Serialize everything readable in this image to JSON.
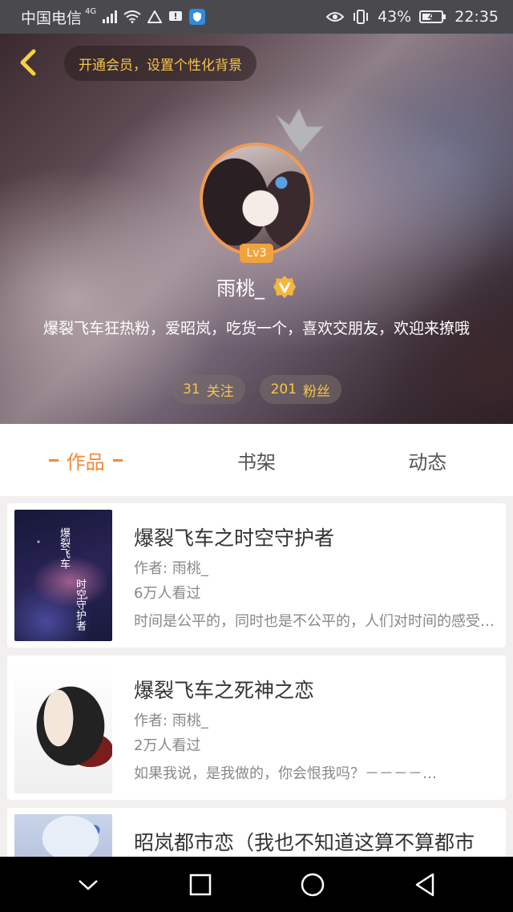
{
  "status_bar": {
    "carrier": "中国电信",
    "network": "4G",
    "battery": "43%",
    "time": "22:35"
  },
  "header": {
    "vip_prompt": "开通会员，设置个性化背景",
    "level": "Lv3",
    "username": "雨桃_",
    "bio": "爆裂飞车狂热粉，爱昭岚，吃货一个，喜欢交朋友，欢迎来撩哦",
    "following": {
      "count": "31",
      "label": "关注"
    },
    "followers": {
      "count": "201",
      "label": "粉丝"
    }
  },
  "tabs": [
    {
      "label": "作品",
      "active": true
    },
    {
      "label": "书架",
      "active": false
    },
    {
      "label": "动态",
      "active": false
    }
  ],
  "works": [
    {
      "title": "爆裂飞车之时空守护者",
      "author": "作者: 雨桃_",
      "views": "6万人看过",
      "desc": "时间是公平的，同时也是不公平的，人们对时间的感受…"
    },
    {
      "title": "爆裂飞车之死神之恋",
      "author": "作者: 雨桃_",
      "views": "2万人看过",
      "desc": "如果我说，是我做的，你会恨我吗？－－－－…"
    },
    {
      "title": "昭岚都市恋（我也不知道这算不算都市",
      "author": "",
      "views": "",
      "desc": ""
    }
  ],
  "colors": {
    "accent": "#f08a3c",
    "gold": "#f7c44a",
    "avatar_border": "#f19a55"
  },
  "icons": {
    "back": "chevron-left-icon",
    "verified": "verified-v-icon",
    "crown": "crown-icon",
    "nav": [
      "chevron-down-icon",
      "square-icon",
      "circle-icon",
      "triangle-back-icon"
    ]
  }
}
